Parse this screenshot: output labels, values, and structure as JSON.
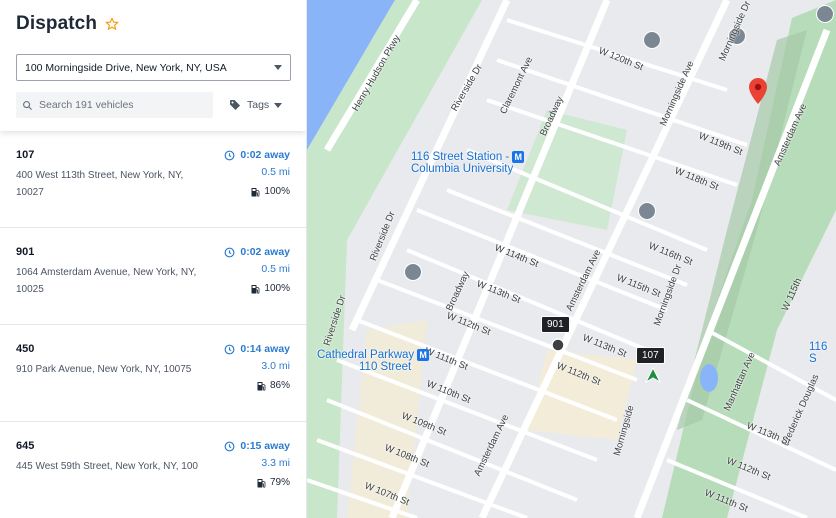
{
  "header": {
    "title": "Dispatch",
    "address_value": "100 Morningside Drive, New York, NY, USA",
    "search_placeholder": "Search 191 vehicles",
    "tags_label": "Tags"
  },
  "vehicles": [
    {
      "id": "107",
      "address_line1": "400 West 113th Street, New York, NY,",
      "address_line2": "10027",
      "eta": "0:02 away",
      "distance": "0.5 mi",
      "fuel": "100%"
    },
    {
      "id": "901",
      "address_line1": "1064 Amsterdam Avenue, New York, NY,",
      "address_line2": "10025",
      "eta": "0:02 away",
      "distance": "0.5 mi",
      "fuel": "100%"
    },
    {
      "id": "450",
      "address_line1": "910 Park Avenue, New York, NY, 10075",
      "address_line2": "",
      "eta": "0:14 away",
      "distance": "3.0 mi",
      "fuel": "86%"
    },
    {
      "id": "645",
      "address_line1": "445 West 59th Street, New York, NY, 100",
      "address_line2": "",
      "eta": "0:15 away",
      "distance": "3.3 mi",
      "fuel": "79%"
    }
  ],
  "map": {
    "streets": {
      "henry_hudson": "Henry Hudson Pkwy",
      "riverside_dr_1": "Riverside Dr",
      "riverside_dr_2": "Riverside Dr",
      "riverside_dr_3": "Riverside Dr",
      "claremont": "Claremont Ave",
      "broadway_1": "Broadway",
      "broadway_2": "Broadway",
      "w120": "W 120th St",
      "w119": "W 119th St",
      "w118": "W 118th St",
      "w116": "W 116th St",
      "w115": "W 115th St",
      "w114": "W 114th St",
      "w113": "W 113th St",
      "w113b": "W 113th St",
      "w112": "W 112th St",
      "w112b": "W 112th St",
      "w111": "W 111th St",
      "w110": "W 110th St",
      "w109": "W 109th St",
      "w108": "W 108th St",
      "w107": "W 107th St",
      "w111b": "W 111th St",
      "amsterdam_1": "Amsterdam Ave",
      "amsterdam_2": "Amsterdam Ave",
      "amsterdam_3": "Amsterdam Ave",
      "morningside_1": "Morningside Ave",
      "morningside_dr_1": "Morningside Dr",
      "morningside_dr_2": "Morningside Dr",
      "morningside_dr_3": "Morningside",
      "manhattan_ave": "Manhattan Ave",
      "frederick": "Frederick Douglas",
      "w113c": "W 113th St",
      "w115b": "W 115th",
      "w112c": "W 112th St"
    },
    "poi": {
      "station116_l1": "116 Street Station -",
      "station116_l2": "Columbia University",
      "cathedral_l1": "Cathedral Parkway",
      "cathedral_l2": "110 Street",
      "subway_glyph": "M",
      "edge_116": "116 S"
    },
    "vehicle_tags": {
      "v901": "901",
      "v107": "107"
    },
    "colors": {
      "water": "#8ab4f8",
      "park": "#c8e6c9",
      "destination_pin": "#ea4335",
      "vehicle_arrow": "#1e8e3e",
      "accent": "#2b7bd1"
    }
  }
}
